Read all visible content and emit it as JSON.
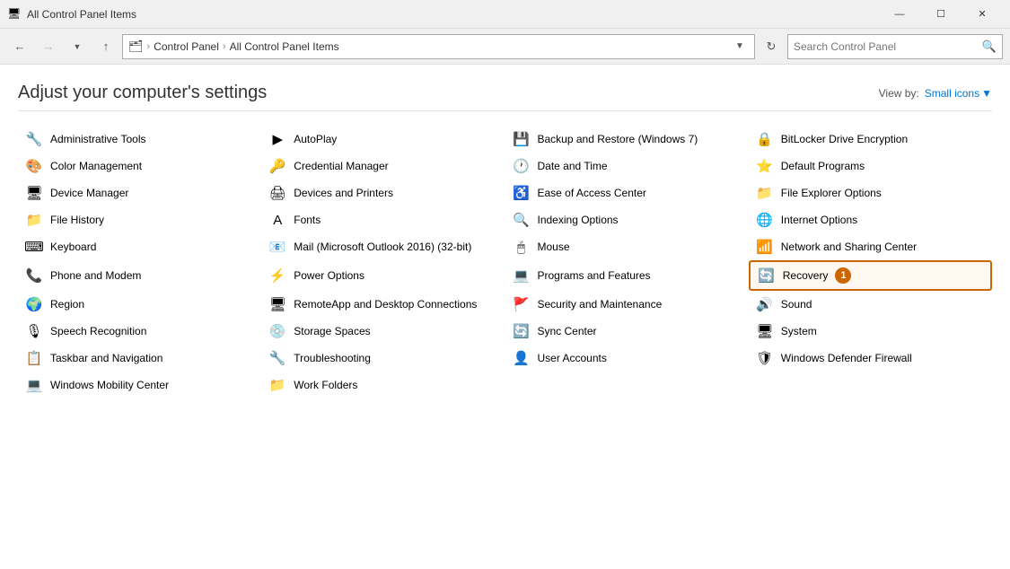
{
  "titlebar": {
    "title": "All Control Panel Items",
    "icon": "🖥",
    "minimize": "—",
    "maximize": "☐",
    "close": "✕"
  },
  "addressbar": {
    "back_disabled": false,
    "forward_disabled": true,
    "up_disabled": false,
    "breadcrumb": [
      "Control Panel",
      "All Control Panel Items"
    ],
    "search_placeholder": "Search Control Panel"
  },
  "content": {
    "title": "Adjust your computer's settings",
    "viewby_label": "View by:",
    "viewby_value": "Small icons",
    "items": [
      {
        "col": 0,
        "label": "Administrative Tools",
        "icon": "🔧"
      },
      {
        "col": 1,
        "label": "AutoPlay",
        "icon": "▶"
      },
      {
        "col": 2,
        "label": "Backup and Restore (Windows 7)",
        "icon": "💾"
      },
      {
        "col": 3,
        "label": "BitLocker Drive Encryption",
        "icon": "🔒"
      },
      {
        "col": 0,
        "label": "Color Management",
        "icon": "🎨"
      },
      {
        "col": 1,
        "label": "Credential Manager",
        "icon": "🔑"
      },
      {
        "col": 2,
        "label": "Date and Time",
        "icon": "🕐"
      },
      {
        "col": 3,
        "label": "Default Programs",
        "icon": "⭐"
      },
      {
        "col": 0,
        "label": "Device Manager",
        "icon": "🖥"
      },
      {
        "col": 1,
        "label": "Devices and Printers",
        "icon": "🖨"
      },
      {
        "col": 2,
        "label": "Ease of Access Center",
        "icon": "♿"
      },
      {
        "col": 3,
        "label": "File Explorer Options",
        "icon": "📁"
      },
      {
        "col": 0,
        "label": "File History",
        "icon": "📁"
      },
      {
        "col": 1,
        "label": "Fonts",
        "icon": "A"
      },
      {
        "col": 2,
        "label": "Indexing Options",
        "icon": "🔍"
      },
      {
        "col": 3,
        "label": "Internet Options",
        "icon": "🌐"
      },
      {
        "col": 0,
        "label": "Keyboard",
        "icon": "⌨"
      },
      {
        "col": 1,
        "label": "Mail (Microsoft Outlook 2016) (32-bit)",
        "icon": "📧"
      },
      {
        "col": 2,
        "label": "Mouse",
        "icon": "🖱"
      },
      {
        "col": 3,
        "label": "Network and Sharing Center",
        "icon": "📶"
      },
      {
        "col": 0,
        "label": "Phone and Modem",
        "icon": "📞"
      },
      {
        "col": 1,
        "label": "Power Options",
        "icon": "⚡"
      },
      {
        "col": 2,
        "label": "Programs and Features",
        "icon": "💻"
      },
      {
        "col": 3,
        "label": "Recovery",
        "icon": "🔄",
        "highlighted": true,
        "badge": "1"
      },
      {
        "col": 0,
        "label": "Region",
        "icon": "🌍"
      },
      {
        "col": 1,
        "label": "RemoteApp and Desktop Connections",
        "icon": "🖥"
      },
      {
        "col": 2,
        "label": "Security and Maintenance",
        "icon": "🚩"
      },
      {
        "col": 3,
        "label": "Sound",
        "icon": "🔊"
      },
      {
        "col": 0,
        "label": "Speech Recognition",
        "icon": "🎙"
      },
      {
        "col": 1,
        "label": "Storage Spaces",
        "icon": "💿"
      },
      {
        "col": 2,
        "label": "Sync Center",
        "icon": "🔄"
      },
      {
        "col": 3,
        "label": "System",
        "icon": "🖥"
      },
      {
        "col": 0,
        "label": "Taskbar and Navigation",
        "icon": "📋"
      },
      {
        "col": 1,
        "label": "Troubleshooting",
        "icon": "🔧"
      },
      {
        "col": 2,
        "label": "User Accounts",
        "icon": "👤"
      },
      {
        "col": 3,
        "label": "Windows Defender Firewall",
        "icon": "🛡"
      },
      {
        "col": 0,
        "label": "Windows Mobility Center",
        "icon": "💻"
      },
      {
        "col": 1,
        "label": "Work Folders",
        "icon": "📁"
      }
    ]
  }
}
